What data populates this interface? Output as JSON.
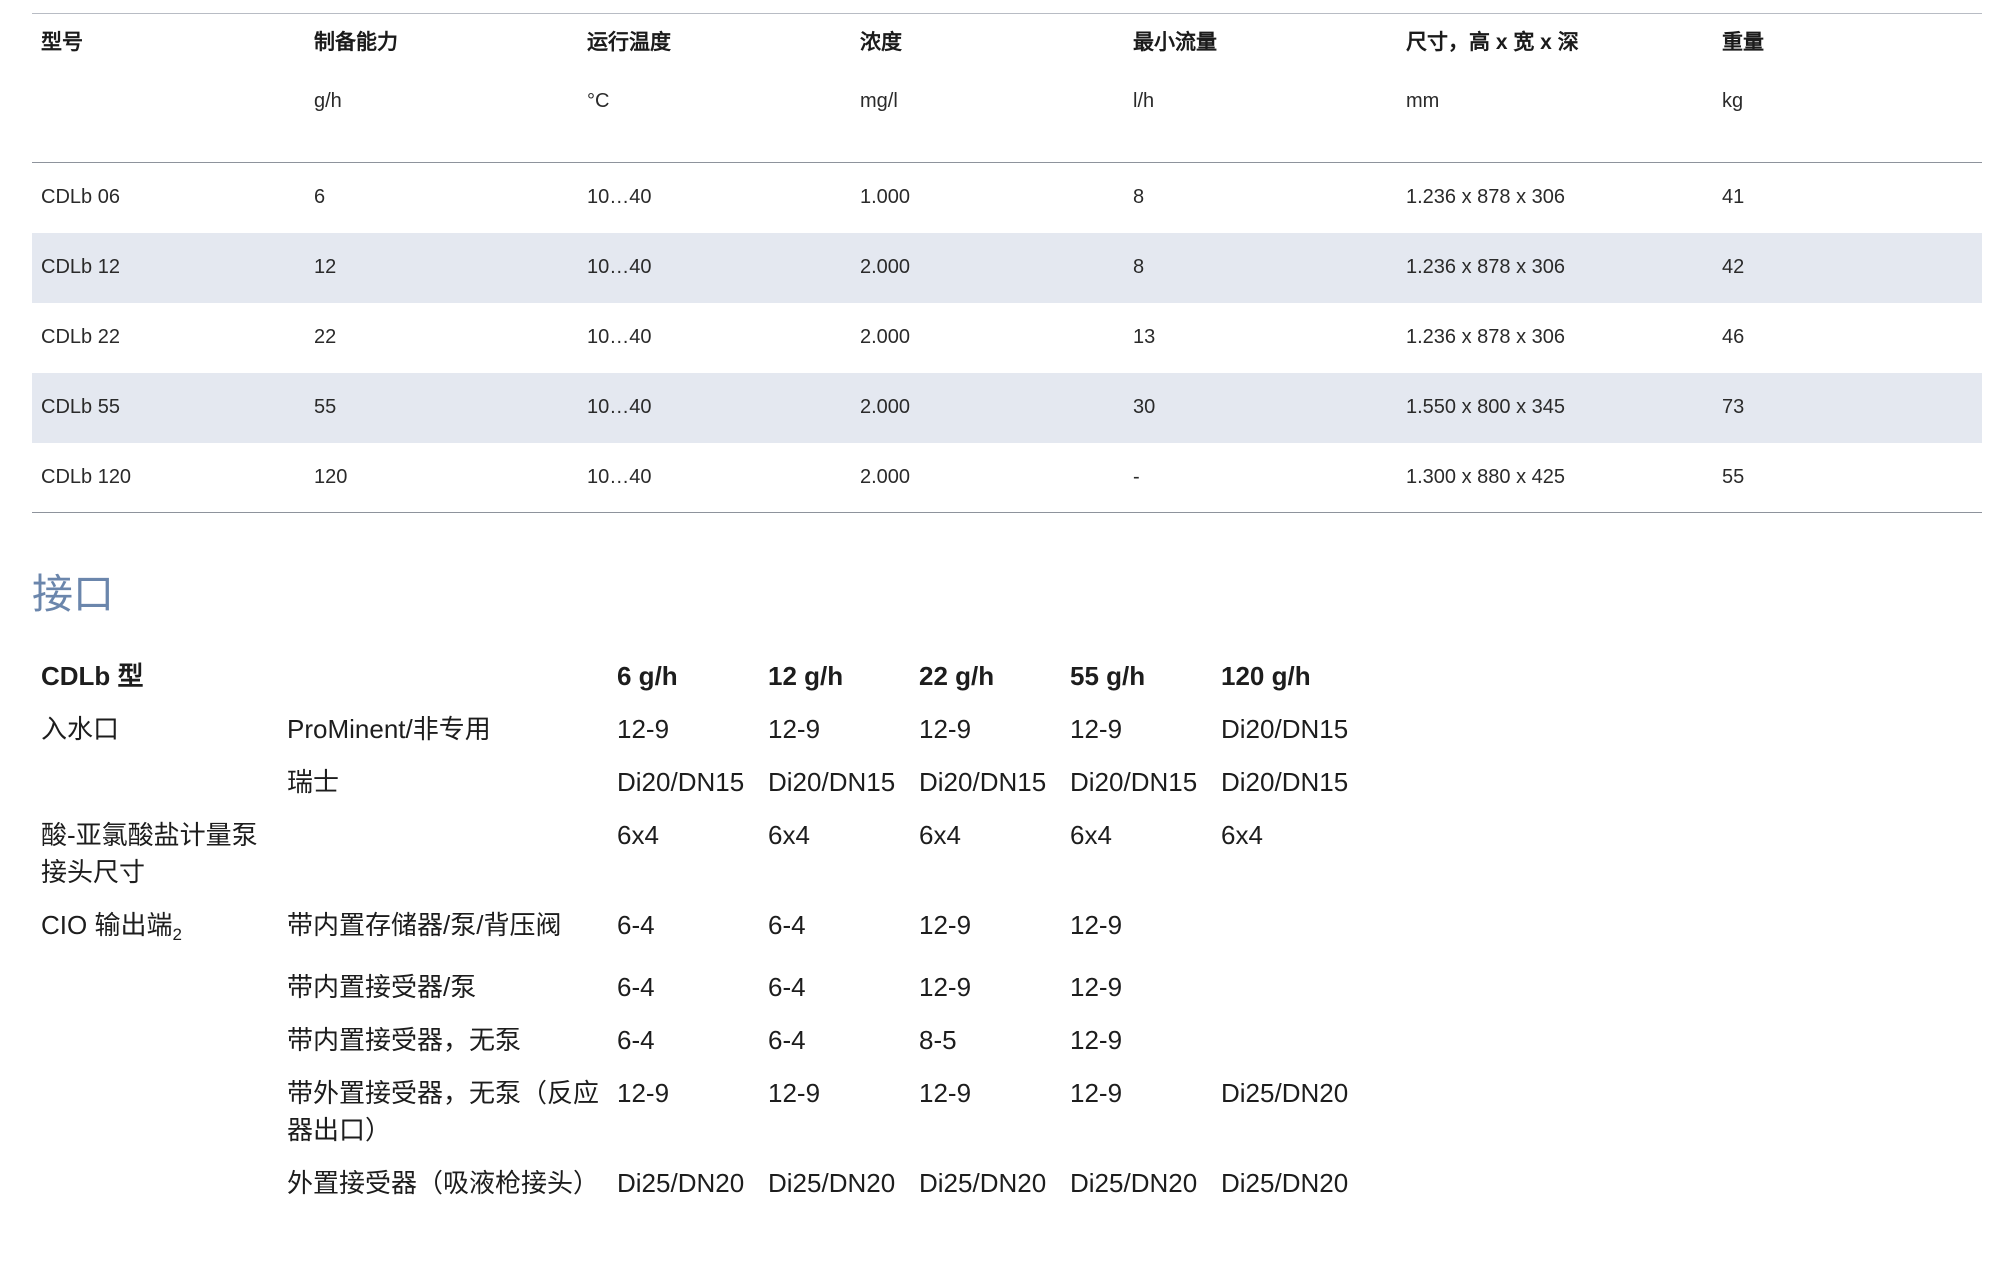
{
  "spec_table": {
    "headers": [
      "型号",
      "制备能力",
      "运行温度",
      "浓度",
      "最小流量",
      "尺寸，高 x 宽 x 深",
      "重量"
    ],
    "units": [
      "",
      "g/h",
      "°C",
      "mg/l",
      "l/h",
      "mm",
      "kg"
    ],
    "rows": [
      [
        "CDLb 06",
        "6",
        "10…40",
        "1.000",
        "8",
        "1.236 x 878 x 306",
        "41"
      ],
      [
        "CDLb 12",
        "12",
        "10…40",
        "2.000",
        "8",
        "1.236 x 878 x 306",
        "42"
      ],
      [
        "CDLb 22",
        "22",
        "10…40",
        "2.000",
        "13",
        "1.236 x 878 x 306",
        "46"
      ],
      [
        "CDLb 55",
        "55",
        "10…40",
        "2.000",
        "30",
        "1.550 x 800 x 345",
        "73"
      ],
      [
        "CDLb 120",
        "120",
        "10…40",
        "2.000",
        "-",
        "1.300 x 880 x 425",
        "55"
      ]
    ]
  },
  "section_title": "接口",
  "conn_table": {
    "header_label": "CDLb 型",
    "sizes": [
      "6 g/h",
      "12 g/h",
      "22 g/h",
      "55 g/h",
      "120 g/h"
    ],
    "rows": [
      {
        "category": "入水口",
        "sub": "ProMinent/非专用",
        "values": [
          "12-9",
          "12-9",
          "12-9",
          "12-9",
          "Di20/DN15"
        ]
      },
      {
        "category": "",
        "sub": "瑞士",
        "values": [
          "Di20/DN15",
          "Di20/DN15",
          "Di20/DN15",
          "Di20/DN15",
          "Di20/DN15"
        ]
      },
      {
        "category": "酸-亚氯酸盐计量泵接头尺寸",
        "sub": "",
        "values": [
          "6x4",
          "6x4",
          "6x4",
          "6x4",
          "6x4"
        ]
      },
      {
        "category": "CIO 输出端",
        "category_sub": "2",
        "sub": "带内置存储器/泵/背压阀",
        "values": [
          "6-4",
          "6-4",
          "12-9",
          "12-9",
          ""
        ]
      },
      {
        "category": "",
        "sub": "带内置接受器/泵",
        "values": [
          "6-4",
          "6-4",
          "12-9",
          "12-9",
          ""
        ]
      },
      {
        "category": "",
        "sub": "带内置接受器，无泵",
        "values": [
          "6-4",
          "6-4",
          "8-5",
          "12-9",
          ""
        ]
      },
      {
        "category": "",
        "sub": "带外置接受器，无泵（反应器出口）",
        "values": [
          "12-9",
          "12-9",
          "12-9",
          "12-9",
          "Di25/DN20"
        ]
      },
      {
        "category": "",
        "sub": "外置接受器（吸液枪接头）",
        "values": [
          "Di25/DN20",
          "Di25/DN20",
          "Di25/DN20",
          "Di25/DN20",
          "Di25/DN20"
        ]
      }
    ]
  }
}
